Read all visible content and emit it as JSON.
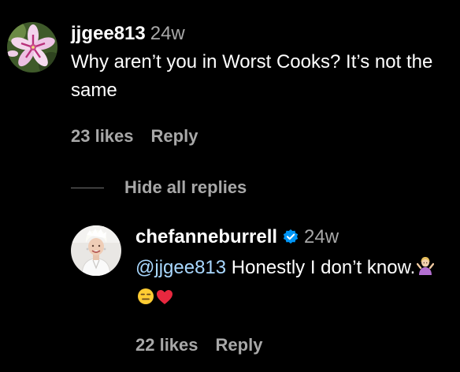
{
  "comments": [
    {
      "username": "jjgee813",
      "age": "24w",
      "text": "Why aren’t you in Worst Cooks? It’s not the same",
      "likes": "23 likes",
      "reply_label": "Reply",
      "avatar_icon": "pink-flower-avatar"
    }
  ],
  "replies_toggle": {
    "label": "Hide all replies"
  },
  "reply": {
    "username": "chefanneburrell",
    "verified": true,
    "age": "24w",
    "mention": "@jjgee813",
    "text": " Honestly I don’t know.",
    "emojis": [
      "woman-shrugging-emoji",
      "expressionless-face-emoji",
      "red-heart-emoji"
    ],
    "likes": "22 likes",
    "reply_label": "Reply",
    "avatar_icon": "chef-portrait-avatar"
  },
  "colors": {
    "background": "#000000",
    "primary_text": "#ffffff",
    "secondary_text": "#a8a8a8",
    "mention": "#a9d8ff",
    "verified_badge": "#0095f6"
  }
}
